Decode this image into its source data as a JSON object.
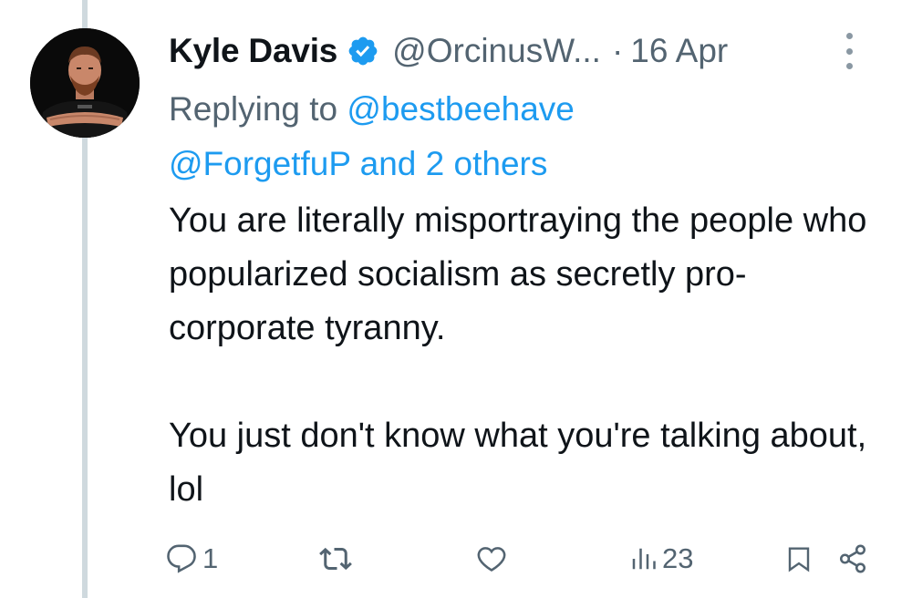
{
  "tweet": {
    "author": {
      "name": "Kyle Davis",
      "handle": "@OrcinusW...",
      "verified": true,
      "verified_color": "#1d9bf0"
    },
    "separator": "·",
    "date": "16 Apr",
    "reply": {
      "prefix": "Replying to",
      "mention1": "@bestbeehave",
      "mention2": "@ForgetfuP",
      "suffix": "and 2 others"
    },
    "text": {
      "paragraph1": "You are literally misportraying the people who popularized socialism as secretly pro-corporate tyranny.",
      "paragraph2": "You just don't know what you're talking about, lol"
    },
    "actions": {
      "reply_count": "1",
      "retweet_count": "",
      "like_count": "",
      "views_count": "23"
    },
    "icons": {
      "more": "more-vertical-icon",
      "reply": "comment-icon",
      "retweet": "retweet-icon",
      "like": "heart-icon",
      "views": "views-icon",
      "bookmark": "bookmark-icon",
      "share": "share-icon"
    },
    "colors": {
      "text": "#0f1419",
      "secondary": "#536471",
      "link": "#1d9bf0",
      "thread_line": "#cfd9de"
    }
  }
}
